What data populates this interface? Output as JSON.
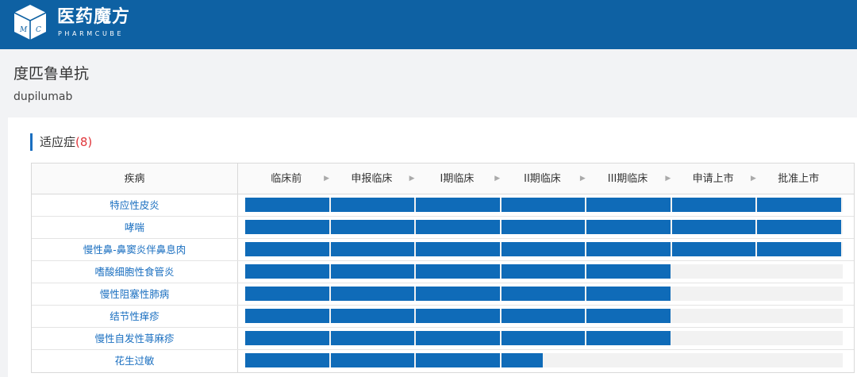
{
  "header": {
    "brand_name": "医药魔方",
    "brand_sub": "PHARMCUBE",
    "logo_letters": [
      "M",
      "C"
    ],
    "bg_color": "#0e61a3"
  },
  "drug": {
    "name_cn": "度匹鲁单抗",
    "name_en": "dupilumab"
  },
  "section": {
    "title": "适应症",
    "count": "(8)"
  },
  "table": {
    "disease_header": "疾病",
    "stages": [
      "临床前",
      "申报临床",
      "I期临床",
      "II期临床",
      "III期临床",
      "申请上市",
      "批准上市"
    ],
    "stage_arrow_icon": "chevron-right-icon",
    "bar_color": "#0f6bb8",
    "rows": [
      {
        "disease": "特应性皮炎",
        "completed_stages": 7
      },
      {
        "disease": "哮喘",
        "completed_stages": 7
      },
      {
        "disease": "慢性鼻-鼻窦炎伴鼻息肉",
        "completed_stages": 7
      },
      {
        "disease": "嗜酸细胞性食管炎",
        "completed_stages": 5
      },
      {
        "disease": "慢性阻塞性肺病",
        "completed_stages": 5
      },
      {
        "disease": "结节性痒疹",
        "completed_stages": 5
      },
      {
        "disease": "慢性自发性荨麻疹",
        "completed_stages": 5
      },
      {
        "disease": "花生过敏",
        "completed_stages": 3.5
      }
    ]
  }
}
